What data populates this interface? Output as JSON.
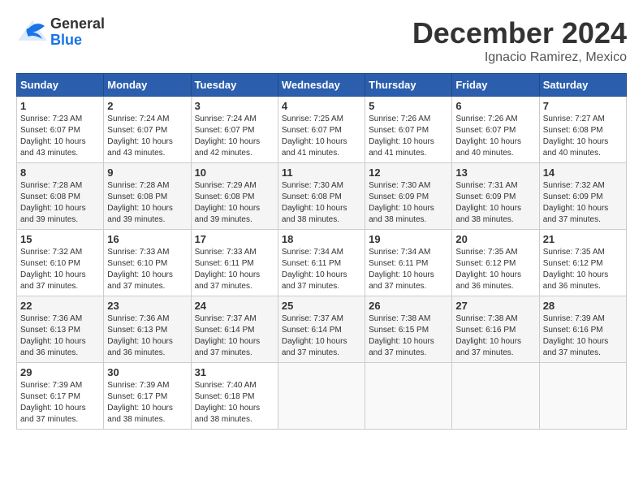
{
  "header": {
    "logo_general": "General",
    "logo_blue": "Blue",
    "month_title": "December 2024",
    "subtitle": "Ignacio Ramirez, Mexico"
  },
  "weekdays": [
    "Sunday",
    "Monday",
    "Tuesday",
    "Wednesday",
    "Thursday",
    "Friday",
    "Saturday"
  ],
  "weeks": [
    [
      {
        "day": "1",
        "info": "Sunrise: 7:23 AM\nSunset: 6:07 PM\nDaylight: 10 hours and 43 minutes."
      },
      {
        "day": "2",
        "info": "Sunrise: 7:24 AM\nSunset: 6:07 PM\nDaylight: 10 hours and 43 minutes."
      },
      {
        "day": "3",
        "info": "Sunrise: 7:24 AM\nSunset: 6:07 PM\nDaylight: 10 hours and 42 minutes."
      },
      {
        "day": "4",
        "info": "Sunrise: 7:25 AM\nSunset: 6:07 PM\nDaylight: 10 hours and 41 minutes."
      },
      {
        "day": "5",
        "info": "Sunrise: 7:26 AM\nSunset: 6:07 PM\nDaylight: 10 hours and 41 minutes."
      },
      {
        "day": "6",
        "info": "Sunrise: 7:26 AM\nSunset: 6:07 PM\nDaylight: 10 hours and 40 minutes."
      },
      {
        "day": "7",
        "info": "Sunrise: 7:27 AM\nSunset: 6:08 PM\nDaylight: 10 hours and 40 minutes."
      }
    ],
    [
      {
        "day": "8",
        "info": "Sunrise: 7:28 AM\nSunset: 6:08 PM\nDaylight: 10 hours and 39 minutes."
      },
      {
        "day": "9",
        "info": "Sunrise: 7:28 AM\nSunset: 6:08 PM\nDaylight: 10 hours and 39 minutes."
      },
      {
        "day": "10",
        "info": "Sunrise: 7:29 AM\nSunset: 6:08 PM\nDaylight: 10 hours and 39 minutes."
      },
      {
        "day": "11",
        "info": "Sunrise: 7:30 AM\nSunset: 6:08 PM\nDaylight: 10 hours and 38 minutes."
      },
      {
        "day": "12",
        "info": "Sunrise: 7:30 AM\nSunset: 6:09 PM\nDaylight: 10 hours and 38 minutes."
      },
      {
        "day": "13",
        "info": "Sunrise: 7:31 AM\nSunset: 6:09 PM\nDaylight: 10 hours and 38 minutes."
      },
      {
        "day": "14",
        "info": "Sunrise: 7:32 AM\nSunset: 6:09 PM\nDaylight: 10 hours and 37 minutes."
      }
    ],
    [
      {
        "day": "15",
        "info": "Sunrise: 7:32 AM\nSunset: 6:10 PM\nDaylight: 10 hours and 37 minutes."
      },
      {
        "day": "16",
        "info": "Sunrise: 7:33 AM\nSunset: 6:10 PM\nDaylight: 10 hours and 37 minutes."
      },
      {
        "day": "17",
        "info": "Sunrise: 7:33 AM\nSunset: 6:11 PM\nDaylight: 10 hours and 37 minutes."
      },
      {
        "day": "18",
        "info": "Sunrise: 7:34 AM\nSunset: 6:11 PM\nDaylight: 10 hours and 37 minutes."
      },
      {
        "day": "19",
        "info": "Sunrise: 7:34 AM\nSunset: 6:11 PM\nDaylight: 10 hours and 37 minutes."
      },
      {
        "day": "20",
        "info": "Sunrise: 7:35 AM\nSunset: 6:12 PM\nDaylight: 10 hours and 36 minutes."
      },
      {
        "day": "21",
        "info": "Sunrise: 7:35 AM\nSunset: 6:12 PM\nDaylight: 10 hours and 36 minutes."
      }
    ],
    [
      {
        "day": "22",
        "info": "Sunrise: 7:36 AM\nSunset: 6:13 PM\nDaylight: 10 hours and 36 minutes."
      },
      {
        "day": "23",
        "info": "Sunrise: 7:36 AM\nSunset: 6:13 PM\nDaylight: 10 hours and 36 minutes."
      },
      {
        "day": "24",
        "info": "Sunrise: 7:37 AM\nSunset: 6:14 PM\nDaylight: 10 hours and 37 minutes."
      },
      {
        "day": "25",
        "info": "Sunrise: 7:37 AM\nSunset: 6:14 PM\nDaylight: 10 hours and 37 minutes."
      },
      {
        "day": "26",
        "info": "Sunrise: 7:38 AM\nSunset: 6:15 PM\nDaylight: 10 hours and 37 minutes."
      },
      {
        "day": "27",
        "info": "Sunrise: 7:38 AM\nSunset: 6:16 PM\nDaylight: 10 hours and 37 minutes."
      },
      {
        "day": "28",
        "info": "Sunrise: 7:39 AM\nSunset: 6:16 PM\nDaylight: 10 hours and 37 minutes."
      }
    ],
    [
      {
        "day": "29",
        "info": "Sunrise: 7:39 AM\nSunset: 6:17 PM\nDaylight: 10 hours and 37 minutes."
      },
      {
        "day": "30",
        "info": "Sunrise: 7:39 AM\nSunset: 6:17 PM\nDaylight: 10 hours and 38 minutes."
      },
      {
        "day": "31",
        "info": "Sunrise: 7:40 AM\nSunset: 6:18 PM\nDaylight: 10 hours and 38 minutes."
      },
      {
        "day": "",
        "info": ""
      },
      {
        "day": "",
        "info": ""
      },
      {
        "day": "",
        "info": ""
      },
      {
        "day": "",
        "info": ""
      }
    ]
  ]
}
